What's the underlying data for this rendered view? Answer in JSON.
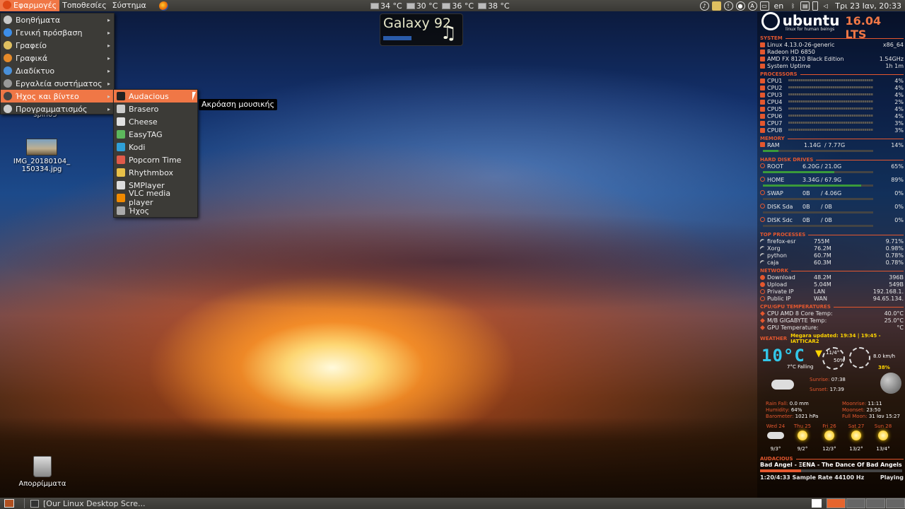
{
  "top_panel": {
    "menus": [
      "Εφαρμογές",
      "Τοποθεσίες",
      "Σύστημα"
    ],
    "temps": [
      "34 °C",
      "30 °C",
      "36 °C",
      "38 °C"
    ],
    "keyboard_layout": "en",
    "clock": "Τρι 23 Ιαν, 20:33"
  },
  "main_menu": {
    "items": [
      {
        "label": "Βοηθήματα",
        "icon": "accessories-icon",
        "color": "#c9c9c9"
      },
      {
        "label": "Γενική πρόσβαση",
        "icon": "accessibility-icon",
        "color": "#3d8ee8"
      },
      {
        "label": "Γραφείο",
        "icon": "office-icon",
        "color": "#e0c060"
      },
      {
        "label": "Γραφικά",
        "icon": "graphics-icon",
        "color": "#e58a2a"
      },
      {
        "label": "Διαδίκτυο",
        "icon": "internet-icon",
        "color": "#4a90d9"
      },
      {
        "label": "Εργαλεία συστήματος",
        "icon": "system-tools-icon",
        "color": "#999999"
      },
      {
        "label": "Ήχος και βίντεο",
        "icon": "multimedia-icon",
        "color": "#444444"
      },
      {
        "label": "Προγραμματισμός",
        "icon": "programming-icon",
        "color": "#cccccc"
      }
    ],
    "active_index": 6
  },
  "sub_menu": {
    "items": [
      {
        "label": "Audacious",
        "icon": "audacious-icon",
        "color": "#222222"
      },
      {
        "label": "Brasero",
        "icon": "brasero-icon",
        "color": "#cccccc"
      },
      {
        "label": "Cheese",
        "icon": "cheese-icon",
        "color": "#e0e0e0"
      },
      {
        "label": "EasyTAG",
        "icon": "easytag-icon",
        "color": "#5cb85c"
      },
      {
        "label": "Kodi",
        "icon": "kodi-icon",
        "color": "#2fa0d8"
      },
      {
        "label": "Popcorn Time",
        "icon": "popcorn-time-icon",
        "color": "#e05a4a"
      },
      {
        "label": "Rhythmbox",
        "icon": "rhythmbox-icon",
        "color": "#e8c048"
      },
      {
        "label": "SMPlayer",
        "icon": "smplayer-icon",
        "color": "#dddddd"
      },
      {
        "label": "VLC media player",
        "icon": "vlc-icon",
        "color": "#f08a00"
      },
      {
        "label": "Ήχος",
        "icon": "sound-icon",
        "color": "#aaaaaa"
      }
    ],
    "active_index": 0
  },
  "tooltip": "Ακρόαση μουσικής",
  "desktop": {
    "partial_label": "spin05",
    "image_file_line1": "IMG_20180104_",
    "image_file_line2": "150334.jpg",
    "trash_label": "Απορρίμματα"
  },
  "galaxy_widget": {
    "title": "Galaxy 92"
  },
  "taskbar": {
    "window_title": "[Our Linux Desktop Scre..."
  },
  "conky": {
    "logo": "ubuntu",
    "tagline": "linux for human beings",
    "version": "16.04 LTS",
    "system": {
      "title": "SYSTEM",
      "rows": [
        {
          "label": "Linux 4.13.0-26-generic",
          "value": "x86_64"
        },
        {
          "label": "Radeon HD 6850",
          "value": ""
        },
        {
          "label": "AMD FX 8120 Black Edition",
          "value": "1.54GHz"
        },
        {
          "label": "System Uptime",
          "value": "1h 1m"
        }
      ]
    },
    "processors": {
      "title": "PROCESSORS",
      "cpus": [
        {
          "label": "CPU1",
          "value": "4%",
          "pct": 4
        },
        {
          "label": "CPU2",
          "value": "4%",
          "pct": 4
        },
        {
          "label": "CPU3",
          "value": "4%",
          "pct": 4
        },
        {
          "label": "CPU4",
          "value": "2%",
          "pct": 2
        },
        {
          "label": "CPU5",
          "value": "4%",
          "pct": 4
        },
        {
          "label": "CPU6",
          "value": "4%",
          "pct": 4
        },
        {
          "label": "CPU7",
          "value": "3%",
          "pct": 3
        },
        {
          "label": "CPU8",
          "value": "3%",
          "pct": 3
        }
      ]
    },
    "memory": {
      "title": "MEMORY",
      "label": "RAM",
      "used": "1.14G",
      "total": "/ 7.77G",
      "value": "14%",
      "pct": 14
    },
    "disks": {
      "title": "HARD DISK DRIVES",
      "rows": [
        {
          "label": "ROOT",
          "used": "6.20G",
          "total": "/ 21.0G",
          "value": "65%",
          "pct": 65
        },
        {
          "label": "HOME",
          "used": "3.34G",
          "total": "/ 67.9G",
          "value": "89%",
          "pct": 89
        },
        {
          "label": "SWAP",
          "used": "0B",
          "total": "/ 4.06G",
          "value": "0%",
          "pct": 0
        },
        {
          "label": "DISK Sda",
          "used": "0B",
          "total": "/ 0B",
          "value": "0%",
          "pct": 0
        },
        {
          "label": "DISK Sdc",
          "used": "0B",
          "total": "/ 0B",
          "value": "0%",
          "pct": 0
        }
      ]
    },
    "processes": {
      "title": "TOP PROCESSES",
      "rows": [
        {
          "name": "firefox-esr",
          "mem": "755M",
          "cpu": "9.71%"
        },
        {
          "name": "Xorg",
          "mem": "76.2M",
          "cpu": "0.98%"
        },
        {
          "name": "python",
          "mem": "60.7M",
          "cpu": "0.78%"
        },
        {
          "name": "caja",
          "mem": "60.3M",
          "cpu": "0.78%"
        }
      ]
    },
    "network": {
      "title": "NETWORK",
      "rows": [
        {
          "label": "Download",
          "mid": "48.2M",
          "value": "396B"
        },
        {
          "label": "Upload",
          "mid": "5.04M",
          "value": "549B"
        },
        {
          "label": "Private IP",
          "mid": "LAN",
          "value": "192.168.1."
        },
        {
          "label": "Public  IP",
          "mid": "WAN",
          "value": "94.65.134."
        }
      ]
    },
    "temperatures": {
      "title": "CPU/GPU TEMPERATURES",
      "rows": [
        {
          "label": "CPU AMD 8 Core Temp:",
          "value": "40.0°C"
        },
        {
          "label": "M/B GIGABYTE Temp:",
          "value": "25.0°C"
        },
        {
          "label": "GPU Temperature:",
          "value": "°C"
        }
      ]
    },
    "weather": {
      "title": "WEATHER",
      "updated": "Megara updated: 19:34 | 19:45 - IATTICAR2",
      "temp": "10°C",
      "feels": "7°C Falling",
      "gauge_temp": "11/4°",
      "gauge_pct": "50%",
      "wind": "8.0 km/h",
      "moon_pct": "38%",
      "sunrise_label": "Sunrise:",
      "sunrise": "07:38",
      "sunset_label": "Sunset:",
      "sunset": "17:39",
      "rainfall_label": "Rain Fall:",
      "rainfall": "0.0 mm",
      "humidity_label": "Humidity:",
      "humidity": "64%",
      "barometer_label": "Barometer:",
      "barometer": "1021 hPa",
      "moonrise_label": "Moonrise:",
      "moonrise": "11:11",
      "moonset_label": "Moonset:",
      "moonset": "23:50",
      "fullmoon_label": "Full Moon:",
      "fullmoon": "31 Ιαν 15:27",
      "forecast": [
        {
          "day": "Wed 24",
          "temp": "9/3°",
          "icon": "cloudy-icon"
        },
        {
          "day": "Thu 25",
          "temp": "9/2°",
          "icon": "sunny-icon"
        },
        {
          "day": "Fri 26",
          "temp": "12/3°",
          "icon": "sunny-icon"
        },
        {
          "day": "Sat 27",
          "temp": "13/2°",
          "icon": "sunny-icon"
        },
        {
          "day": "Sun 28",
          "temp": "13/4°",
          "icon": "sunny-icon"
        }
      ]
    },
    "audacious": {
      "title": "AUDACIOUS",
      "song": "Bad Angel - ΞENA - The Dance Of Bad Angels",
      "time": "1:20/4:33",
      "sample_rate": "Sample Rate 44100 Hz",
      "status": "Playing",
      "progress": 0.29
    }
  },
  "colors": {
    "accent": "#f07746",
    "conky_heading": "#e4572e",
    "panel": "#3c3b37"
  }
}
